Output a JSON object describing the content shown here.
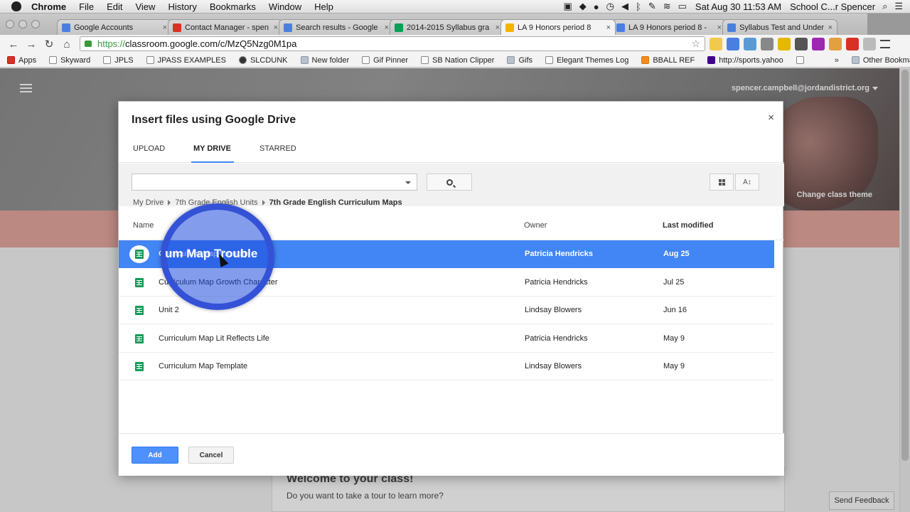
{
  "menubar": {
    "app": "Chrome",
    "items": [
      "File",
      "Edit",
      "View",
      "History",
      "Bookmarks",
      "Window",
      "Help"
    ],
    "clock": "Sat Aug 30  11:53 AM",
    "user": "School C...r Spencer"
  },
  "tabs": [
    {
      "label": "Google Accounts",
      "favicon_color": "#4a7fe0"
    },
    {
      "label": "Contact Manager - spen",
      "favicon_color": "#d93025"
    },
    {
      "label": "Search results - Google",
      "favicon_color": "#4a7fe0"
    },
    {
      "label": "2014-2015 Syllabus gra",
      "favicon_color": "#0f9d58"
    },
    {
      "label": "LA 9 Honors period 8",
      "favicon_color": "#f4b400"
    },
    {
      "label": "LA 9 Honors period 8 -",
      "favicon_color": "#4a7fe0"
    },
    {
      "label": "Syllabus Test and Under",
      "favicon_color": "#4a7fe0"
    }
  ],
  "toolbar": {
    "url_scheme": "https://",
    "url_rest": "classroom.google.com/c/MzQ5Nzg0M1pa"
  },
  "bookmarks": {
    "items": [
      "Apps",
      "Skyward",
      "JPLS",
      "JPASS EXAMPLES",
      "SLCDUNK",
      "New folder",
      "Gif Pinner",
      "SB Nation Clipper",
      "Gifs",
      "Elegant Themes Log",
      "BBALL REF",
      "http://sports.yahoo"
    ],
    "chevron": "»",
    "other": "Other Bookmarks"
  },
  "classroom": {
    "user_email": "spencer.campbell@jordandistrict.org",
    "change_theme": "Change class theme",
    "welcome_title": "Welcome to your class!",
    "welcome_sub": "Do you want to take a tour to learn more?",
    "send_feedback": "Send Feedback"
  },
  "dialog": {
    "title": "Insert files using Google Drive",
    "close": "×",
    "tabs": [
      "UPLOAD",
      "MY DRIVE",
      "STARRED"
    ],
    "active_tab": "MY DRIVE",
    "search_placeholder": "",
    "breadcrumb": [
      "My Drive",
      "7th Grade English Units",
      "7th Grade English Curriculum Maps"
    ],
    "columns": {
      "name": "Name",
      "owner": "Owner",
      "modified": "Last modified"
    },
    "files": [
      {
        "name": "Curriculum Map Trouble",
        "owner": "Patricia Hendricks",
        "modified": "Aug 25",
        "selected": true
      },
      {
        "name": "Curriculum Map Growth Character",
        "owner": "Patricia Hendricks",
        "modified": "Jul 25",
        "selected": false
      },
      {
        "name": "Unit 2",
        "owner": "Lindsay Blowers",
        "modified": "Jun 16",
        "selected": false
      },
      {
        "name": "Curriculum Map Lit Reflects Life",
        "owner": "Patricia Hendricks",
        "modified": "May 9",
        "selected": false
      },
      {
        "name": "Curriculum Map Template",
        "owner": "Lindsay Blowers",
        "modified": "May 9",
        "selected": false
      }
    ],
    "add_label": "Add",
    "cancel_label": "Cancel"
  },
  "zoom": {
    "text": "um Map Trouble"
  },
  "colors": {
    "accent": "#4285f4",
    "sheets": "#0f9d58",
    "banner_salmon": "#e5a39c"
  }
}
